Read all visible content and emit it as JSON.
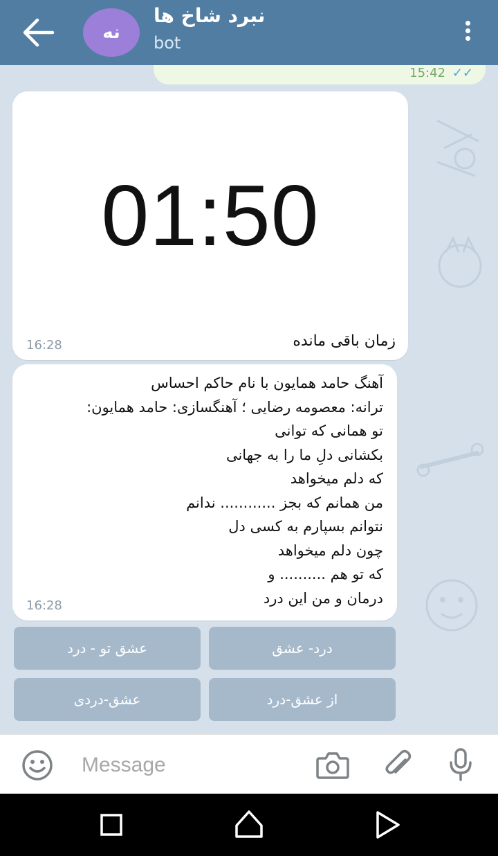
{
  "header": {
    "avatar_initials": "نه",
    "title": "نبرد شاخ ها",
    "subtitle": "bot"
  },
  "previous_message": {
    "time": "15:42",
    "ticks": "✓✓"
  },
  "timer_message": {
    "timer": "01:50",
    "caption": "زمان باقی مانده",
    "time": "16:28"
  },
  "lyrics_message": {
    "lines": [
      "آهنگ حامد همایون با نام حاکم احساس",
      "ترانه: معصومه رضایی ؛ آهنگسازی: حامد همایون:",
      "تو همانی که توانی",
      "بکشانی دلِ ما را به جهانی",
      "که دلم میخواهد",
      "من همانم که بجز ............ ندانم",
      "نتوانم بسپارم به کسی دل",
      "چون دلم میخواهد",
      "که تو هم .......... و",
      "درمان و من این درد"
    ],
    "time": "16:28"
  },
  "keyboard": {
    "row1": [
      "درد- عشق",
      "عشق تو - درد"
    ],
    "row2": [
      "از عشق-درد",
      "عشق-دردی"
    ]
  },
  "input": {
    "placeholder": "Message",
    "value": ""
  },
  "colors": {
    "header": "#517da2",
    "chat_background": "#d5e0ea",
    "keyboard_button": "#a6b9cb",
    "outgoing_bubble": "#eef8e4"
  }
}
